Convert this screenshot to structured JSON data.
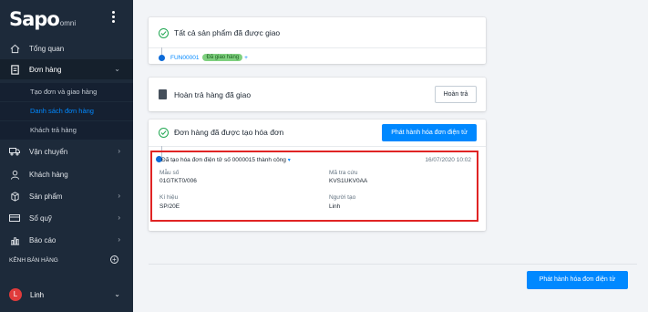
{
  "logo": {
    "brand": "Sapo",
    "sub": "omni"
  },
  "sidebar": {
    "items": [
      {
        "label": "Tổng quan",
        "icon": "home-icon"
      },
      {
        "label": "Đơn hàng",
        "icon": "orders-icon"
      },
      {
        "label": "Vận chuyển",
        "icon": "truck-icon"
      },
      {
        "label": "Khách hàng",
        "icon": "customer-icon"
      },
      {
        "label": "Sản phẩm",
        "icon": "product-icon"
      },
      {
        "label": "Sổ quỹ",
        "icon": "cashbook-icon"
      },
      {
        "label": "Báo cáo",
        "icon": "report-icon"
      }
    ],
    "sub_items": [
      {
        "label": "Tạo đơn và giao hàng"
      },
      {
        "label": "Danh sách đơn hàng"
      },
      {
        "label": "Khách trả hàng"
      }
    ],
    "channels_label": "KÊNH BÁN HÀNG",
    "user": {
      "initial": "L",
      "name": "Linh"
    }
  },
  "card1": {
    "title": "Tất cả sản phẩm đã được giao",
    "order_code": "FUN00001",
    "badge": "Đã giao hàng",
    "plus": "+"
  },
  "card2": {
    "title": "Hoàn trả hàng đã giao",
    "button": "Hoàn trả"
  },
  "card3": {
    "title": "Đơn hàng đã được tạo hóa đơn",
    "button": "Phát hành hóa đơn điện tử",
    "message": "Đã tạo hóa đơn điện tử số 0000015 thành công",
    "date": "16/07/2020 10:02",
    "fields": {
      "template_label": "Mẫu số",
      "template_value": "01GTKT0/006",
      "lookup_label": "Mã tra cứu",
      "lookup_value": "KVS1UKV0AA",
      "symbol_label": "Kí hiệu",
      "symbol_value": "SP/20E",
      "creator_label": "Người tạo",
      "creator_value": "Linh"
    }
  },
  "footer": {
    "button": "Phát hành hóa đơn điện tử"
  },
  "colors": {
    "sidebar_bg": "#1d2a3a",
    "accent": "#0088ff",
    "success": "#22a853",
    "highlight_border": "#e02424"
  }
}
